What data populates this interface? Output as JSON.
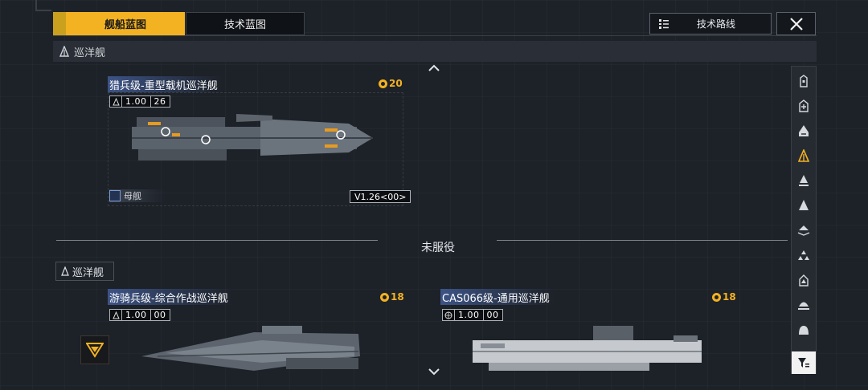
{
  "tabs": [
    {
      "label": "舰船蓝图",
      "active": true
    },
    {
      "label": "技术蓝图",
      "active": false
    }
  ],
  "header": {
    "tech_route_label": "技术路线",
    "close_icon": "close-icon"
  },
  "section": {
    "title": "巡洋舰",
    "icon": "cruiser-class-icon"
  },
  "cards": [
    {
      "title": "猎兵级-重型载机巡洋舰",
      "cost": "20",
      "level_main": "1.00",
      "level_sub": "26",
      "tag": "母舰",
      "version": "V1.26<00>"
    },
    {
      "title": "游骑兵级-综合作战巡洋舰",
      "cost": "18",
      "level_main": "1.00",
      "level_sub": "00"
    },
    {
      "title": "CAS066级-通用巡洋舰",
      "cost": "18",
      "level_main": "1.00",
      "level_sub": "00"
    }
  ],
  "divider_label": "未服役",
  "sub_section_title": "巡洋舰",
  "rail_icons": [
    "frigate-class-icon",
    "destroyer-class-icon",
    "destroyer-alt-class-icon",
    "cruiser-class-icon",
    "battlecruiser-class-icon",
    "auxiliary-class-icon",
    "carrier-class-icon",
    "corvette-class-icon",
    "station-class-icon",
    "heavy-class-icon",
    "dome-class-icon"
  ],
  "colors": {
    "accent": "#f3b221",
    "background": "#1d2128",
    "title_blue": "#425c96"
  }
}
